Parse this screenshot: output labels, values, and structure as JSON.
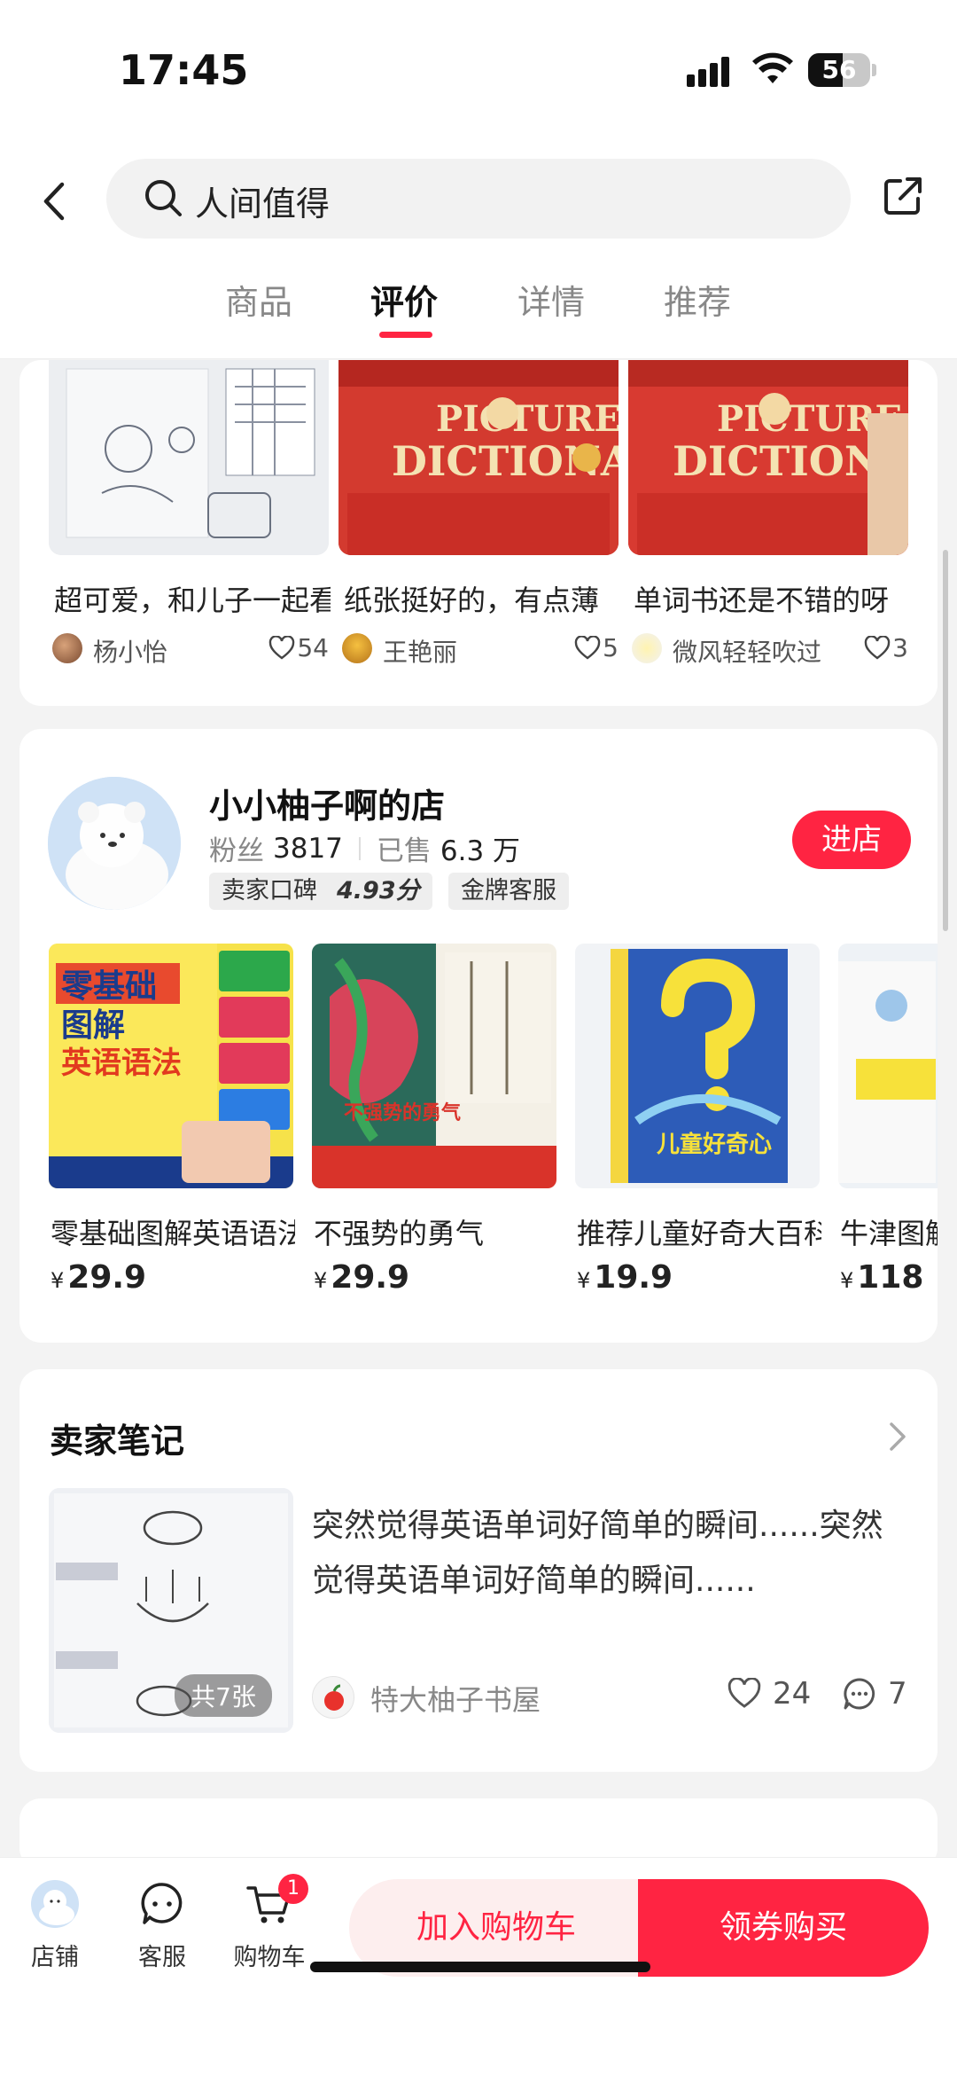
{
  "status_bar": {
    "time": "17:45",
    "battery": "56"
  },
  "header": {
    "search_text": "人间值得",
    "tabs": [
      {
        "label": "商品",
        "active": false
      },
      {
        "label": "评价",
        "active": true
      },
      {
        "label": "详情",
        "active": false
      },
      {
        "label": "推荐",
        "active": false
      }
    ]
  },
  "reviews": [
    {
      "text": "超可爱，和儿子一起看",
      "author": "杨小怡",
      "likes": "54"
    },
    {
      "text": "纸张挺好的，有点薄",
      "author": "王艳丽",
      "likes": "5"
    },
    {
      "text": "单词书还是不错的呀",
      "author": "微风轻轻吹过",
      "likes": "3"
    }
  ],
  "store": {
    "name": "小小柚子啊的店",
    "fans_label": "粉丝",
    "fans": "3817",
    "sold_label": "已售",
    "sold": "6.3 万",
    "rating_label": "卖家口碑",
    "rating": "4.93分",
    "service_badge": "金牌客服",
    "enter_label": "进店",
    "products": [
      {
        "title": "零基础图解英语语法",
        "currency": "¥",
        "price": "29.9"
      },
      {
        "title": "不强势的勇气",
        "currency": "¥",
        "price": "29.9"
      },
      {
        "title": "推荐儿童好奇大百科",
        "currency": "¥",
        "price": "19.9"
      },
      {
        "title": "牛津图解",
        "currency": "¥",
        "price": "118"
      }
    ]
  },
  "notes": {
    "title": "卖家笔记",
    "text": "突然觉得英语单词好简单的瞬间......突然觉得英语单词好简单的瞬间......",
    "image_count": "共7张",
    "author": "特大柚子书屋",
    "likes": "24",
    "comments": "7"
  },
  "bottom_bar": {
    "store_label": "店铺",
    "service_label": "客服",
    "cart_label": "购物车",
    "cart_badge": "1",
    "add_cart_label": "加入购物车",
    "buy_label": "领券购买"
  },
  "colors": {
    "accent": "#ff2442"
  }
}
